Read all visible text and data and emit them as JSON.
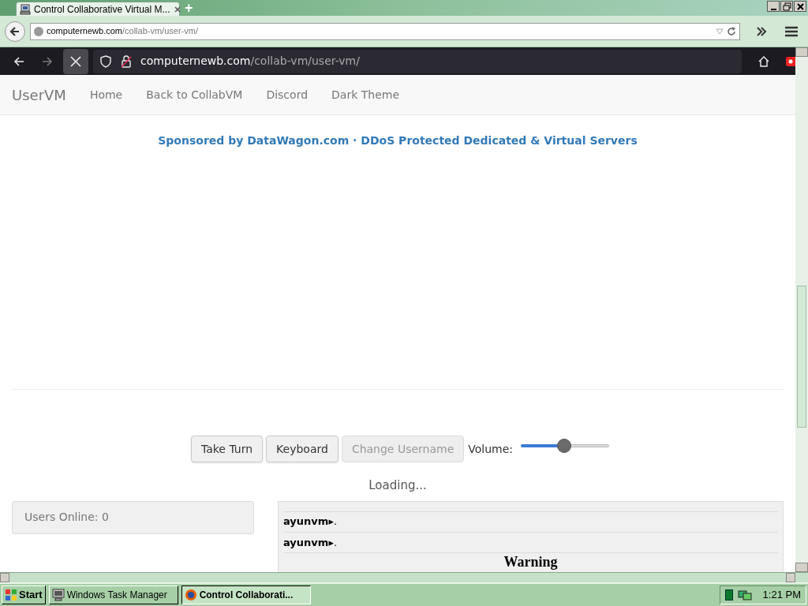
{
  "outer_browser": {
    "tab": {
      "title": "Control Collaborative Virtual M...",
      "selected": true
    },
    "new_tab": "+",
    "url_host": "computernewb.com",
    "url_path": "/collab-vm/user-vm/"
  },
  "inner_browser": {
    "url_host": "computernewb.com",
    "url_path": "/collab-vm/user-vm/"
  },
  "site": {
    "brand": "UserVM",
    "nav": [
      "Home",
      "Back to CollabVM",
      "Discord",
      "Dark Theme"
    ],
    "sponsor": "Sponsored by DataWagon.com · DDoS Protected Dedicated & Virtual Servers",
    "buttons": [
      {
        "label": "Take Turn",
        "disabled": false
      },
      {
        "label": "Keyboard",
        "disabled": false
      },
      {
        "label": "Change Username",
        "disabled": true
      }
    ],
    "volume": {
      "label": "Volume:",
      "level": 0.49
    },
    "loading": "Loading...",
    "users_online": "Users Online: 0",
    "chat": [
      {
        "user": "ayunvm▸",
        "message": "."
      },
      {
        "user": "ayunvm▸",
        "message": "."
      }
    ],
    "chat_heading": "Warning"
  },
  "taskbar": {
    "start": "Start",
    "items": [
      {
        "label": "Windows Task Manager",
        "selected": false
      },
      {
        "label": "Control Collaborati...",
        "selected": true
      }
    ],
    "clock": "1:21 PM"
  }
}
